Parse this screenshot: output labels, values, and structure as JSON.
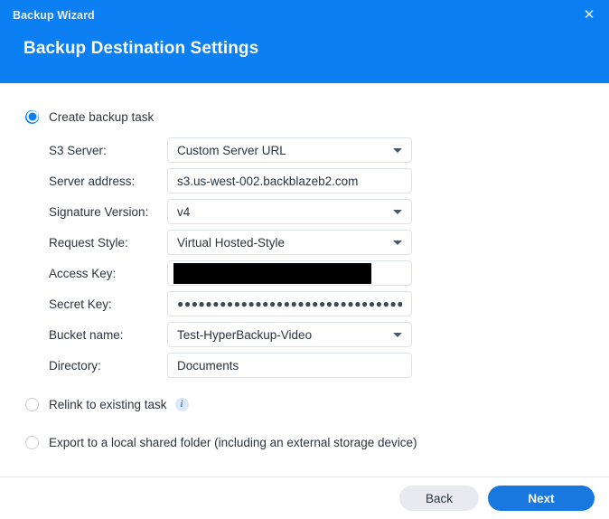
{
  "window": {
    "title": "Backup Wizard",
    "close_label": "✕",
    "page_title": "Backup Destination Settings"
  },
  "options": {
    "create": {
      "label": "Create backup task",
      "selected": true
    },
    "relink": {
      "label": "Relink to existing task",
      "selected": false,
      "info_glyph": "i"
    },
    "export": {
      "label": "Export to a local shared folder (including an external storage device)",
      "selected": false
    }
  },
  "form": {
    "fields": [
      {
        "label": "S3 Server:",
        "value": "Custom Server URL",
        "type": "select",
        "name": "s3-server"
      },
      {
        "label": "Server address:",
        "value": "s3.us-west-002.backblazeb2.com",
        "type": "text",
        "name": "server-address"
      },
      {
        "label": "Signature Version:",
        "value": "v4",
        "type": "select",
        "name": "signature-version"
      },
      {
        "label": "Request Style:",
        "value": "Virtual Hosted-Style",
        "type": "select",
        "name": "request-style"
      },
      {
        "label": "Access Key:",
        "value": "",
        "type": "redacted",
        "name": "access-key"
      },
      {
        "label": "Secret Key:",
        "value": "●●●●●●●●●●●●●●●●●●●●●●●●●●●●●●●●●●",
        "type": "password",
        "name": "secret-key"
      },
      {
        "label": "Bucket name:",
        "value": "Test-HyperBackup-Video",
        "type": "select",
        "name": "bucket-name"
      },
      {
        "label": "Directory:",
        "value": "Documents",
        "type": "text",
        "name": "directory"
      }
    ]
  },
  "footer": {
    "back_label": "Back",
    "next_label": "Next"
  },
  "colors": {
    "header_blue": "#0c7ff2",
    "accent_blue": "#1878e0",
    "back_gray": "#e8eaef",
    "field_border": "#dde3ec",
    "info_bg": "#dce9fb"
  }
}
